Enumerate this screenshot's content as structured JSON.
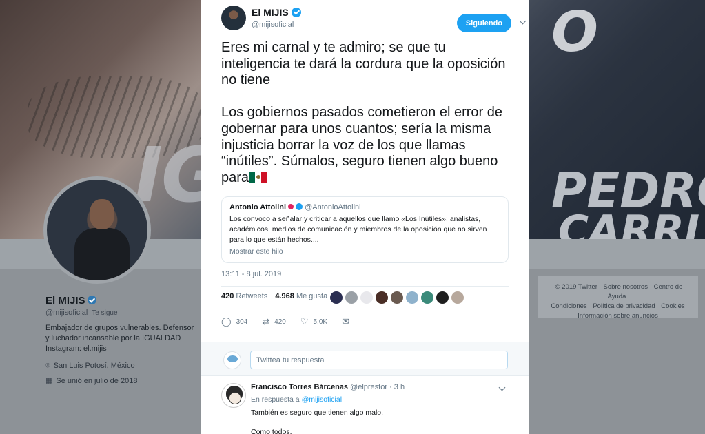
{
  "background_profile": {
    "banner_text_1": "IG",
    "banner_text_2": "PEDRO",
    "banner_text_3": "CARRI",
    "banner_text_4": "O",
    "name": "El MIJIS",
    "handle": "@mijisoficial",
    "follows_you": "Te sigue",
    "bio": "Embajador de grupos vulnerables. Defensor y luchador incansable por la IGUALDAD Instagram: el.mijis",
    "location": "San Luis Potosí, México",
    "joined": "Se unió en julio de 2018",
    "footer_links": [
      "© 2019 Twitter",
      "Sobre nosotros",
      "Centro de Ayuda",
      "Condiciones",
      "Política de privacidad",
      "Cookies",
      "Información sobre anuncios"
    ]
  },
  "tweet": {
    "author_name": "El MIJIS",
    "author_handle": "@mijisoficial",
    "follow_label": "Siguiendo",
    "text": "Eres mi carnal y te admiro; se que tu inteligencia te dará la cordura que la oposición no tiene\n\nLos gobiernos pasados cometieron el error de gobernar para unos cuantos; sería la misma injusticia borrar la voz de los que llamas “inútiles”. Súmalos, seguro tienen algo bueno para",
    "timestamp": "13:11 - 8 jul. 2019",
    "retweets_count": "420",
    "retweets_label": "Retweets",
    "likes_count": "4.968",
    "likes_label": "Me gusta",
    "reply_count": "304",
    "retweet_count_short": "420",
    "like_count_short": "5,0K",
    "icons": {
      "reply": "reply-icon",
      "retweet": "retweet-icon",
      "like": "heart-icon",
      "dm": "message-icon"
    }
  },
  "quoted": {
    "name": "Antonio Attolini",
    "handle": "@AntonioAttolini",
    "text": "Los convoco a señalar y criticar a aquellos que llamo «Los Inútiles»: analistas, académicos, medios de comunicación y miembros de la oposición que no sirven para lo que están hechos....",
    "show_thread": "Mostrar este hilo"
  },
  "reply_box": {
    "placeholder": "Twittea tu respuesta"
  },
  "reply": {
    "name": "Francisco Torres Bárcenas",
    "handle_time": "@elprestor · 3 h",
    "in_reply_prefix": "En respuesta a",
    "in_reply_handle": "@mijisoficial",
    "text_1": "También es seguro que tienen algo malo.",
    "text_2": "Como todos."
  },
  "colors": {
    "accent": "#1da1f2",
    "text": "#14171a",
    "muted": "#657786"
  }
}
